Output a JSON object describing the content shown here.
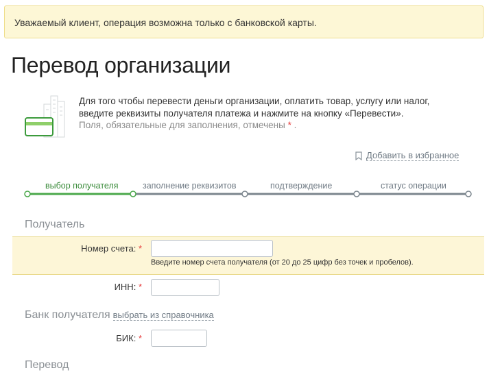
{
  "notice": {
    "text": "Уважаемый клиент, операция возможна только с банковской карты."
  },
  "page": {
    "title": "Перевод организации"
  },
  "intro": {
    "line1": "Для того чтобы перевести деньги организации, оплатить товар, услугу или налог,",
    "line2": "введите реквизиты получателя платежа и нажмите на кнопку «Перевести».",
    "required_note": "Поля, обязательные для заполнения, отмечены",
    "required_mark": "*",
    "required_tail": "."
  },
  "favorites": {
    "label": "Добавить в избранное",
    "icon": "bookmark-icon"
  },
  "steps": {
    "items": [
      {
        "label": "выбор получателя",
        "state": "active"
      },
      {
        "label": "заполнение реквизитов",
        "state": "pending"
      },
      {
        "label": "подтверждение",
        "state": "pending"
      },
      {
        "label": "статус операции",
        "state": "pending"
      }
    ],
    "colors": {
      "active": "#4aa84a",
      "pending": "#7b858d"
    }
  },
  "sections": {
    "recipient": "Получатель",
    "bank": "Банк получателя",
    "transfer": "Перевод"
  },
  "form": {
    "account": {
      "label": "Номер счета:",
      "required": "*",
      "value": "",
      "hint": "Введите номер счета получателя (от 20 до 25 цифр без точек и пробелов)."
    },
    "inn": {
      "label": "ИНН:",
      "required": "*",
      "value": ""
    },
    "bank_link": "выбрать из справочника",
    "bik": {
      "label": "БИК:",
      "required": "*",
      "value": ""
    }
  }
}
